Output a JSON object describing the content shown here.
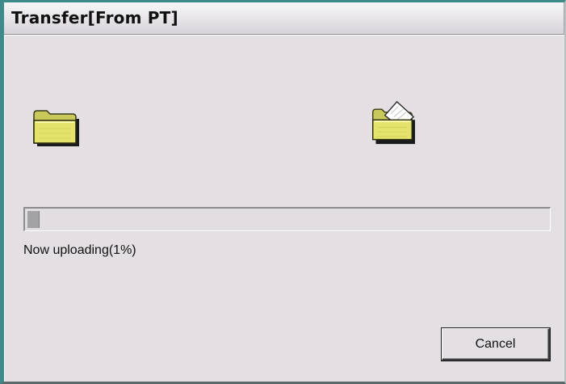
{
  "window": {
    "title": "Transfer[From PT]"
  },
  "icons": {
    "source": "folder-closed-icon",
    "target": "folder-open-with-document-icon"
  },
  "progress": {
    "percent": 1,
    "status_text": "Now uploading(1%)"
  },
  "buttons": {
    "cancel_label": "Cancel"
  },
  "colors": {
    "window_border": "#3f8a8a",
    "background": "#e3dfe2",
    "folder_yellow": "#e4e36b",
    "progress_fill": "#a3a3a6"
  }
}
